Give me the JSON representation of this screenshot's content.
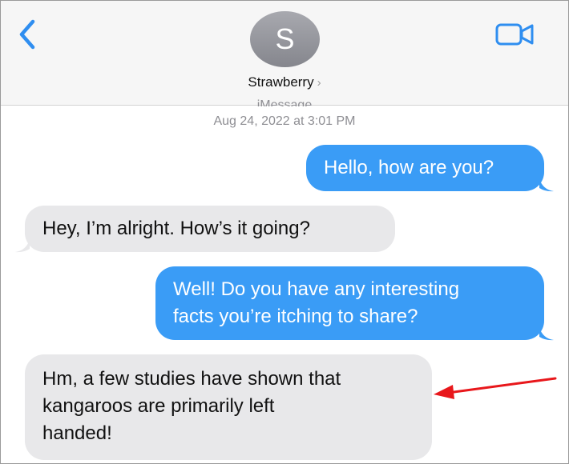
{
  "header": {
    "avatar_initial": "S",
    "contact_name": "Strawberry",
    "contact_chevron": "›"
  },
  "conversation": {
    "service_label": "iMessage",
    "timestamp": "Aug 24, 2022 at 3:01 PM",
    "messages": [
      {
        "sender": "me",
        "lines": [
          "Hello, how are you?"
        ]
      },
      {
        "sender": "contact",
        "lines": [
          "Hey, I’m alright. How’s it going?"
        ]
      },
      {
        "sender": "me",
        "lines": [
          "Well! Do you have any interesting",
          "facts you’re itching to share?"
        ]
      },
      {
        "sender": "contact",
        "lines": [
          "Hm, a few studies have shown that",
          "kangaroos are primarily left",
          "handed!"
        ]
      }
    ]
  },
  "icons": {
    "back": "chevron-left-icon",
    "video": "video-camera-icon",
    "annotation": "red-arrow-icon"
  },
  "colors": {
    "accent": "#2f8ef0",
    "sent_bubble": "#3a9cf6",
    "received_bubble": "#e8e8ea",
    "annotation_arrow": "#e8171b"
  }
}
